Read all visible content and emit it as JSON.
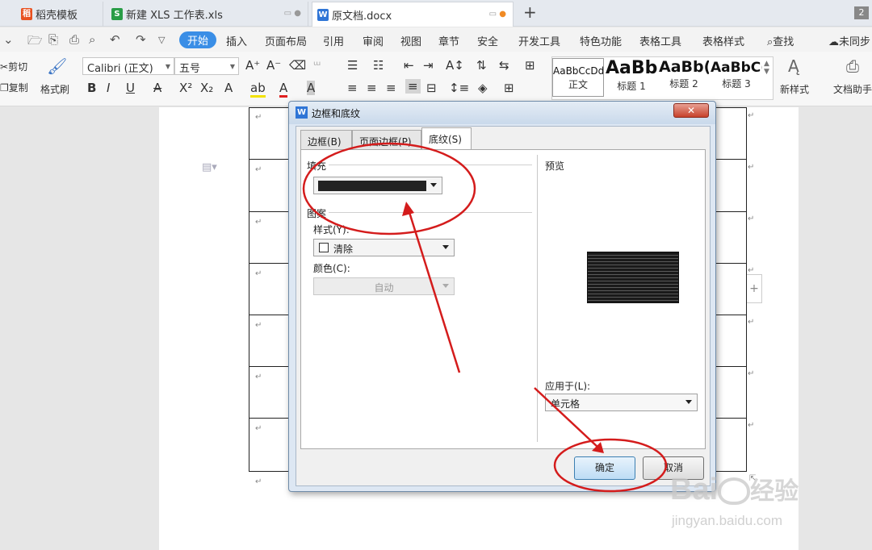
{
  "tabs": [
    {
      "label": "稻壳模板",
      "icon": "docer-flame-icon",
      "color": "#e8501f"
    },
    {
      "label": "新建 XLS 工作表.xls",
      "icon": "spreadsheet-icon",
      "color": "#2a9d47"
    },
    {
      "label": "原文档.docx",
      "icon": "writer-icon",
      "color": "#2f75d6"
    }
  ],
  "tab_counter": "2",
  "menu": {
    "items": [
      "开始",
      "插入",
      "页面布局",
      "引用",
      "审阅",
      "视图",
      "章节",
      "安全",
      "开发工具",
      "特色功能",
      "表格工具",
      "表格样式"
    ],
    "search": "查找",
    "sync": "未同步"
  },
  "ribbon": {
    "cut": "剪切",
    "copy": "复制",
    "format_painter": "格式刷",
    "font_name": "Calibri (正文)",
    "font_size": "五号",
    "styles": [
      {
        "preview": "AaBbCcDd",
        "label": "正文"
      },
      {
        "preview": "AaBb",
        "label": "标题 1"
      },
      {
        "preview": "AaBb(",
        "label": "标题 2"
      },
      {
        "preview": "AaBbC(",
        "label": "标题 3"
      }
    ],
    "new_style": "新样式",
    "doc_helper": "文档助手"
  },
  "dialog": {
    "title": "边框和底纹",
    "tabs": [
      "边框(B)",
      "页面边框(P)",
      "底纹(S)"
    ],
    "active_tab": "底纹(S)",
    "fill_label": "填充",
    "fill_color": "#222222",
    "pattern_label": "图案",
    "style_label": "样式(Y):",
    "style_value": "清除",
    "color_label": "颜色(C):",
    "color_value": "自动",
    "preview_label": "预览",
    "apply_label": "应用于(L):",
    "apply_value": "单元格",
    "ok": "确定",
    "cancel": "取消"
  },
  "watermark": {
    "brand": "Bai",
    "brand2": "经验",
    "url": "jingyan.baidu.com"
  },
  "colors": {
    "accent": "#3a8ee6",
    "annotation": "#d41c1c"
  }
}
